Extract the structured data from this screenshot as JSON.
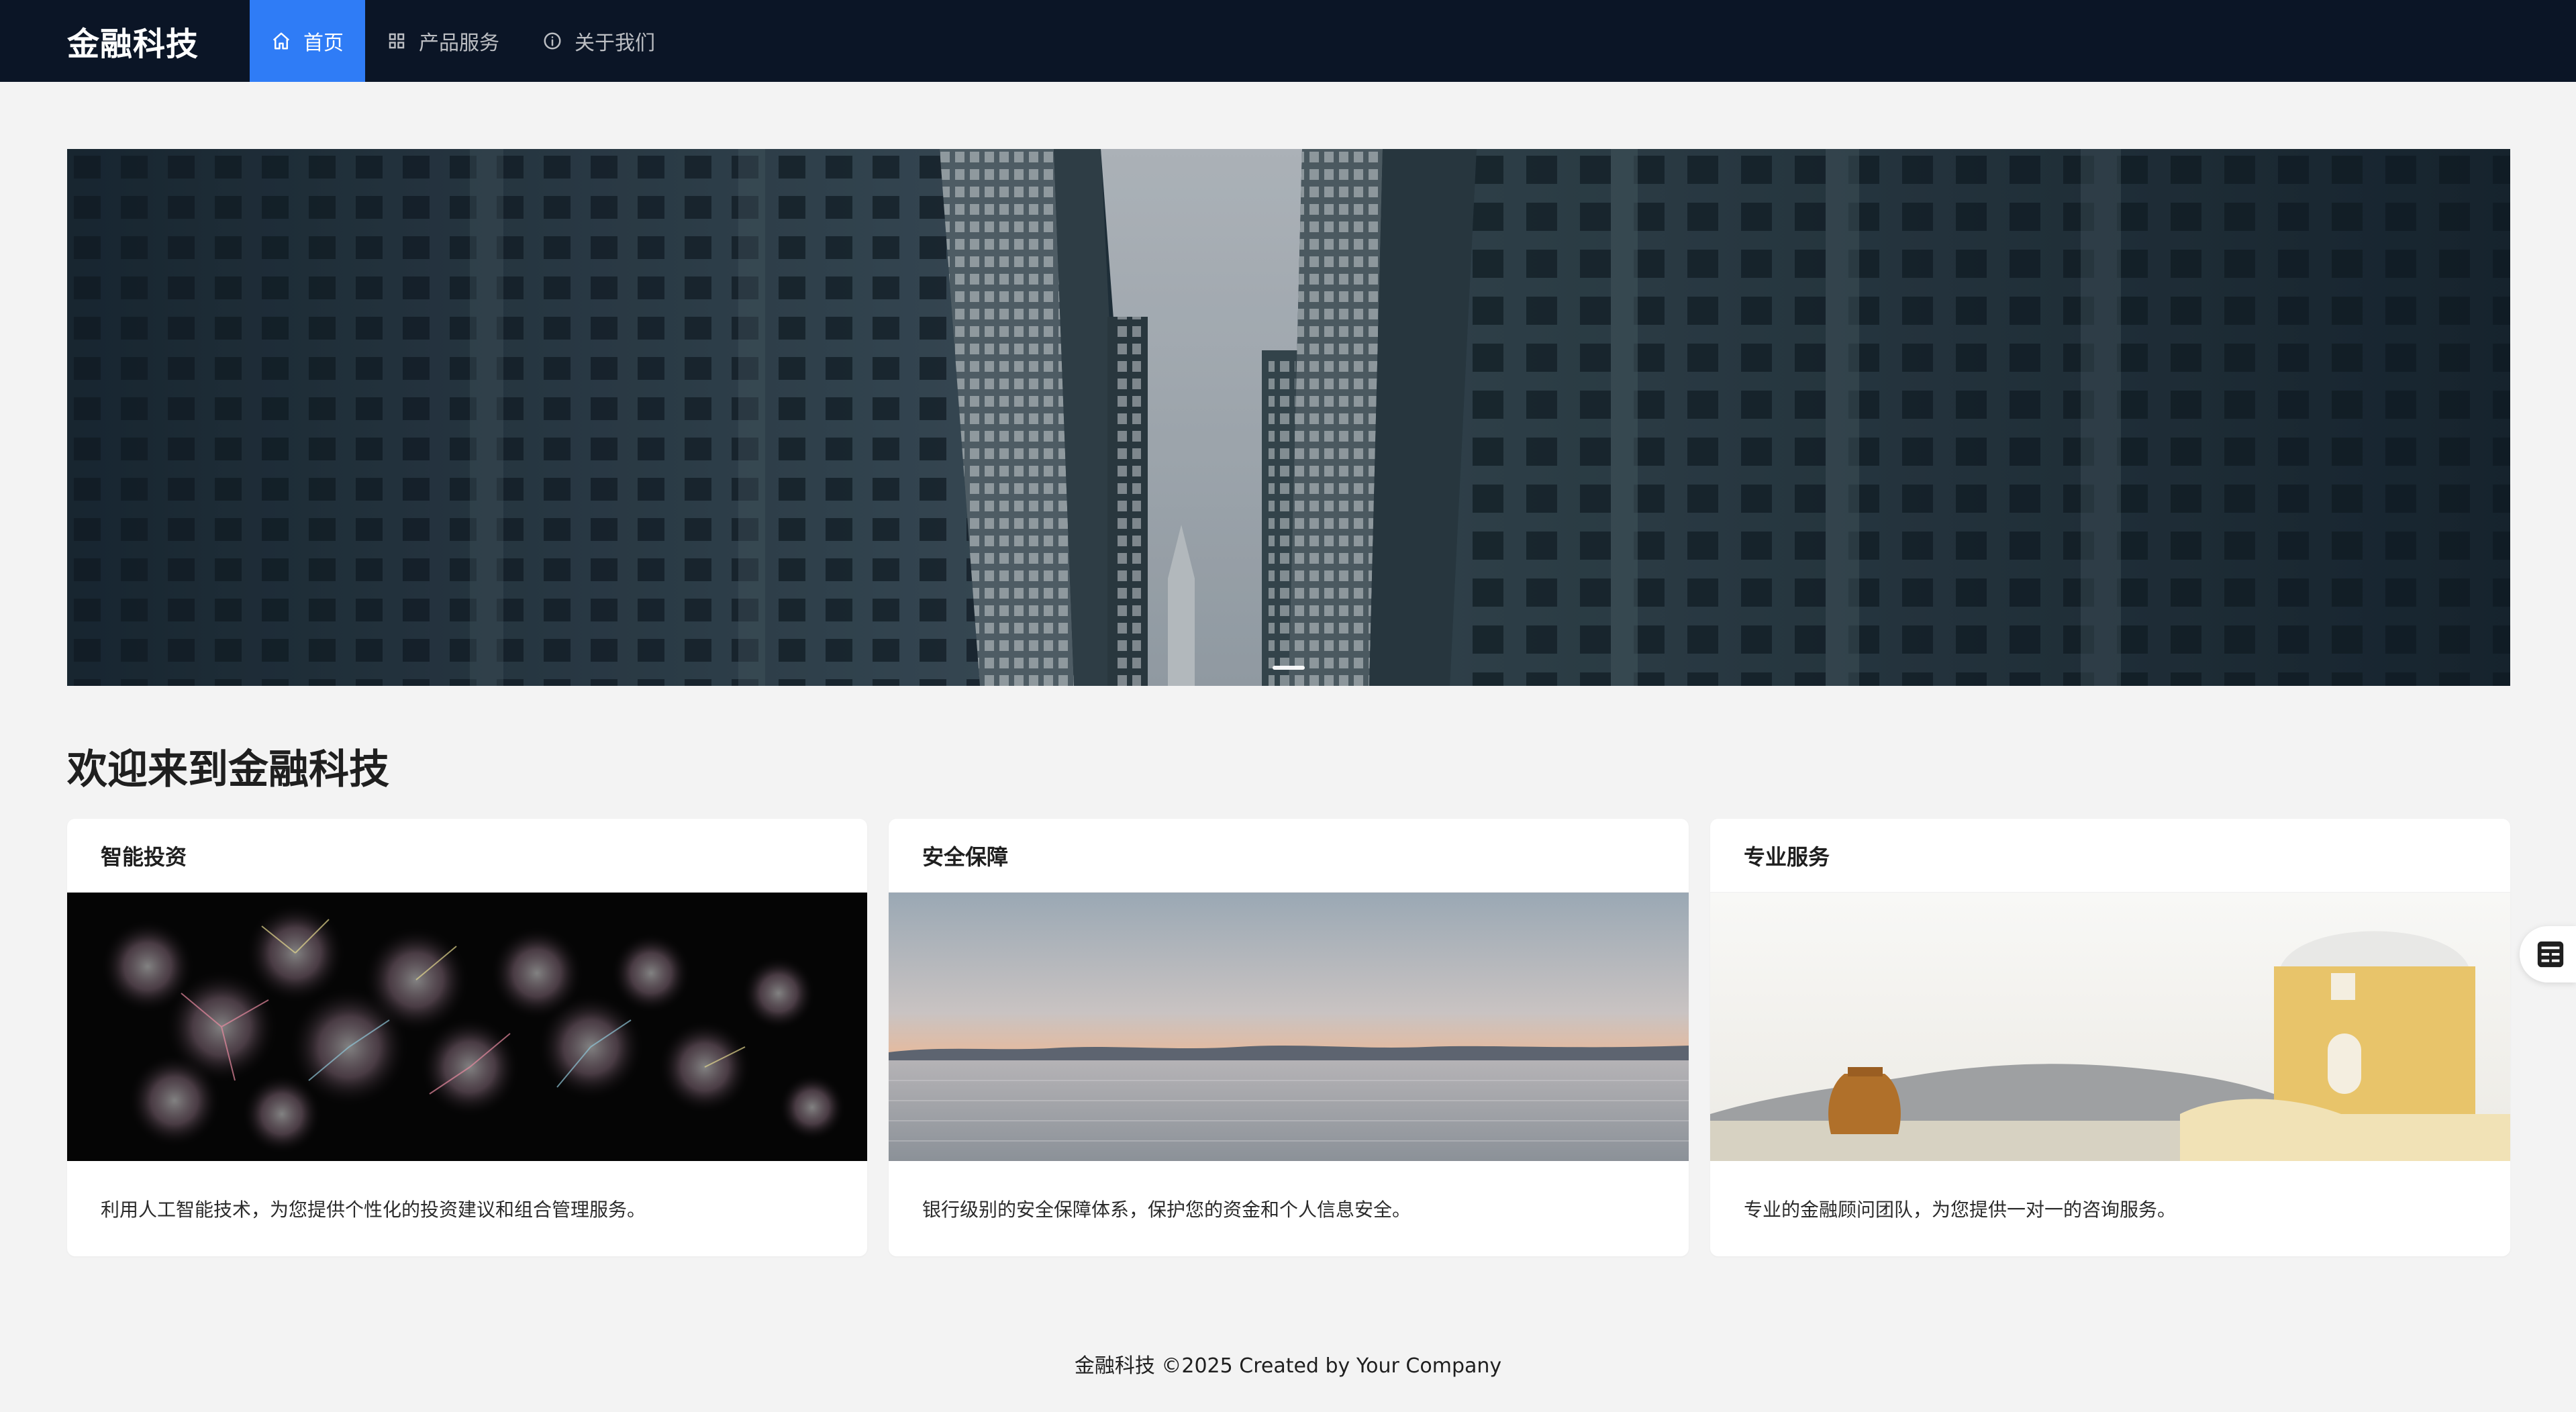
{
  "header": {
    "logo": "金融科技",
    "nav": [
      {
        "label": "首页",
        "icon": "home-icon",
        "active": true
      },
      {
        "label": "产品服务",
        "icon": "grid-icon",
        "active": false
      },
      {
        "label": "关于我们",
        "icon": "info-circle-icon",
        "active": false
      }
    ]
  },
  "hero": {
    "image": "city-skyscrapers-banner",
    "slides_count": 1,
    "current_slide": 1
  },
  "main": {
    "title": "欢迎来到金融科技",
    "cards": [
      {
        "title": "智能投资",
        "image": "fireworks-image",
        "description": "利用人工智能技术，为您提供个性化的投资建议和组合管理服务。"
      },
      {
        "title": "安全保障",
        "image": "sea-sunset-image",
        "description": "银行级别的安全保障体系，保护您的资金和个人信息安全。"
      },
      {
        "title": "专业服务",
        "image": "santorini-building-image",
        "description": "专业的金融顾问团队，为您提供一对一的咨询服务。"
      }
    ]
  },
  "floating_button": {
    "icon": "form-icon"
  },
  "footer": {
    "text": "金融科技 ©2025 Created by Your Company"
  },
  "colors": {
    "header_bg": "#0b1526",
    "nav_active": "#2f7cf6",
    "page_bg": "#f3f3f3",
    "card_bg": "#ffffff"
  }
}
